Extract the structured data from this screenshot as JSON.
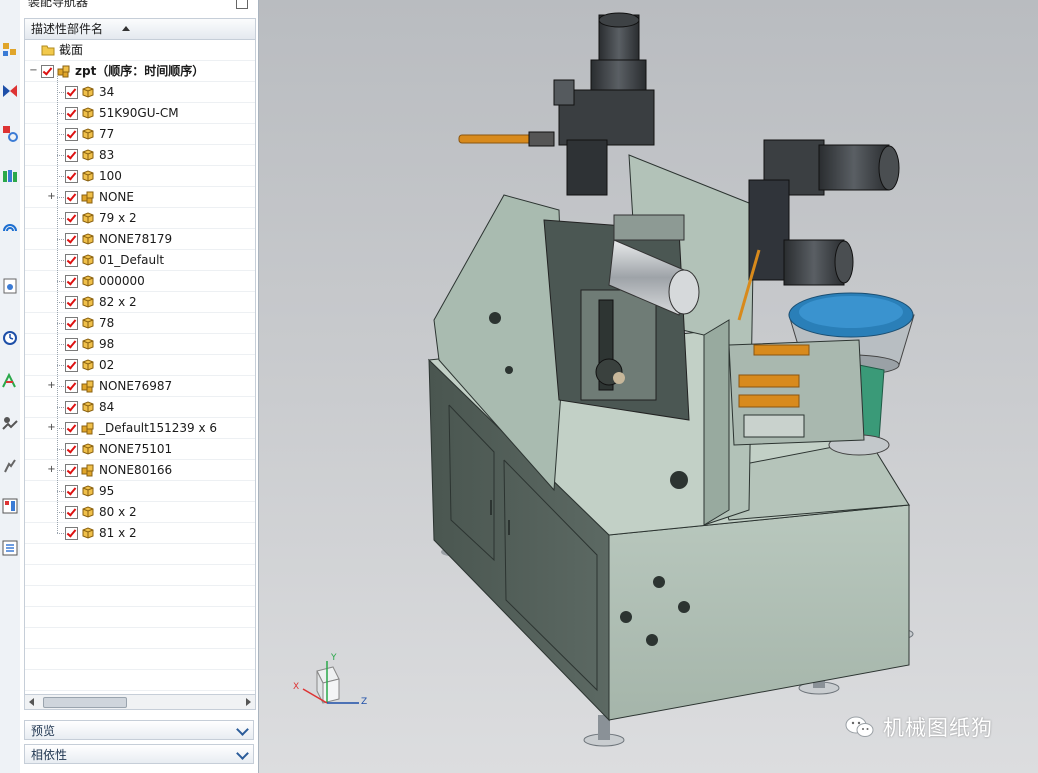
{
  "navigator": {
    "title": "装配导航器",
    "column_header": "描述性部件名",
    "items": [
      {
        "label": "截面",
        "type": "folder",
        "level": 0,
        "expand": "",
        "checked": false
      },
      {
        "label": "zpt（顺序：时间顺序）",
        "type": "assembly",
        "level": 0,
        "expand": "−",
        "checked": true
      },
      {
        "label": "34",
        "type": "part",
        "level": 1,
        "expand": "",
        "checked": true
      },
      {
        "label": "51K90GU-CM",
        "type": "part",
        "level": 1,
        "expand": "",
        "checked": true
      },
      {
        "label": "77",
        "type": "part",
        "level": 1,
        "expand": "",
        "checked": true
      },
      {
        "label": "83",
        "type": "part",
        "level": 1,
        "expand": "",
        "checked": true
      },
      {
        "label": "100",
        "type": "part",
        "level": 1,
        "expand": "",
        "checked": true
      },
      {
        "label": "NONE",
        "type": "assembly",
        "level": 1,
        "expand": "+",
        "checked": true
      },
      {
        "label": "79 x 2",
        "type": "part",
        "level": 1,
        "expand": "",
        "checked": true
      },
      {
        "label": "NONE78179",
        "type": "part",
        "level": 1,
        "expand": "",
        "checked": true
      },
      {
        "label": "01_Default",
        "type": "part",
        "level": 1,
        "expand": "",
        "checked": true
      },
      {
        "label": "000000",
        "type": "part",
        "level": 1,
        "expand": "",
        "checked": true
      },
      {
        "label": "82 x 2",
        "type": "part",
        "level": 1,
        "expand": "",
        "checked": true
      },
      {
        "label": "78",
        "type": "part",
        "level": 1,
        "expand": "",
        "checked": true
      },
      {
        "label": "98",
        "type": "part",
        "level": 1,
        "expand": "",
        "checked": true
      },
      {
        "label": "02",
        "type": "part",
        "level": 1,
        "expand": "",
        "checked": true
      },
      {
        "label": "NONE76987",
        "type": "assembly",
        "level": 1,
        "expand": "+",
        "checked": true
      },
      {
        "label": "84",
        "type": "part",
        "level": 1,
        "expand": "",
        "checked": true
      },
      {
        "label": "_Default151239 x 6",
        "type": "assembly",
        "level": 1,
        "expand": "+",
        "checked": true
      },
      {
        "label": "NONE75101",
        "type": "part",
        "level": 1,
        "expand": "",
        "checked": true
      },
      {
        "label": "NONE80166",
        "type": "assembly",
        "level": 1,
        "expand": "+",
        "checked": true
      },
      {
        "label": "95",
        "type": "part",
        "level": 1,
        "expand": "",
        "checked": true
      },
      {
        "label": "80 x 2",
        "type": "part",
        "level": 1,
        "expand": "",
        "checked": true
      },
      {
        "label": "81 x 2",
        "type": "part",
        "level": 1,
        "expand": "",
        "checked": true
      }
    ],
    "sections": [
      {
        "label": "预览"
      },
      {
        "label": "相依性"
      }
    ]
  },
  "viewport": {
    "triad_labels": {
      "x": "X",
      "y": "Y",
      "z": "Z"
    },
    "watermark": "机械图纸狗"
  },
  "colors": {
    "panel_bg": "#ffffff",
    "viewport_top": "#b9bcc0",
    "viewport_bottom": "#dcdddf",
    "machine_body": "#a8b8ae",
    "machine_dark": "#3e4a45",
    "bowl_blue": "#2a7fb8",
    "accent_orange": "#d88a1c"
  },
  "rail_icons": [
    "assembly-navigator-icon",
    "constraint-navigator-icon",
    "part-navigator-icon",
    "reuse-library-icon",
    "web-browser-icon",
    "history-icon",
    "system-materials-icon",
    "process-studio-icon",
    "roles-icon",
    "palette-icon",
    "info-list-icon"
  ]
}
